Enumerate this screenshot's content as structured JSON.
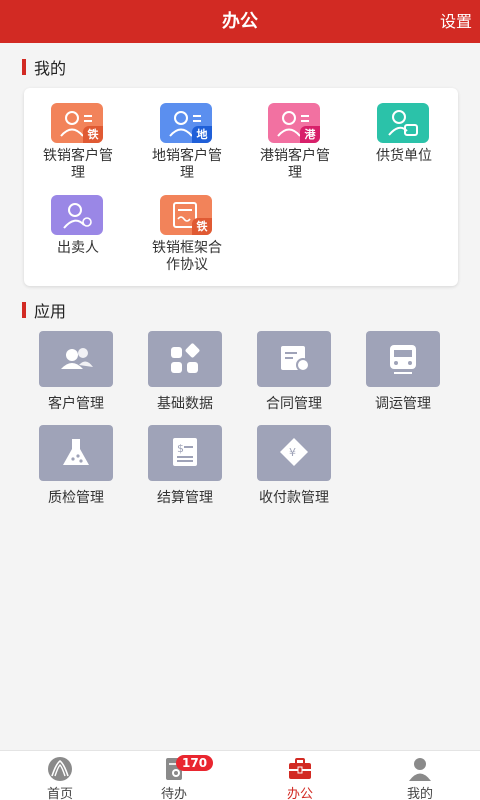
{
  "header": {
    "title": "办公",
    "settings_label": "设置"
  },
  "mine": {
    "title": "我的",
    "items": [
      {
        "label_line1": "铁销客户管",
        "label_line2": "理",
        "icon": "user-list-icon",
        "color": "#f2835a",
        "badge": "铁",
        "badge_color": "#e05a33"
      },
      {
        "label_line1": "地销客户管",
        "label_line2": "理",
        "icon": "user-list-icon",
        "color": "#5b8fef",
        "badge": "地",
        "badge_color": "#1f5fd8"
      },
      {
        "label_line1": "港销客户管",
        "label_line2": "理",
        "icon": "user-list-icon",
        "color": "#f271a1",
        "badge": "港",
        "badge_color": "#d8206a"
      },
      {
        "label_line1": "供货单位",
        "label_line2": "",
        "icon": "supplier-icon",
        "color": "#2bc2a9",
        "badge": "",
        "badge_color": ""
      },
      {
        "label_line1": "出卖人",
        "label_line2": "",
        "icon": "seller-icon",
        "color": "#9a87e6",
        "badge": "",
        "badge_color": ""
      },
      {
        "label_line1": "铁销框架合",
        "label_line2": "作协议",
        "icon": "agreement-icon",
        "color": "#f2835a",
        "badge": "铁",
        "badge_color": "#e05a33"
      }
    ]
  },
  "apps": {
    "title": "应用",
    "items": [
      {
        "label": "客户管理",
        "icon": "customers-icon"
      },
      {
        "label": "基础数据",
        "icon": "grid-icon"
      },
      {
        "label": "合同管理",
        "icon": "contract-icon"
      },
      {
        "label": "调运管理",
        "icon": "train-icon"
      },
      {
        "label": "质检管理",
        "icon": "flask-icon"
      },
      {
        "label": "结算管理",
        "icon": "invoice-icon"
      },
      {
        "label": "收付款管理",
        "icon": "payment-icon"
      }
    ]
  },
  "tabbar": {
    "items": [
      {
        "label": "首页",
        "icon": "home-logo-icon",
        "active": false
      },
      {
        "label": "待办",
        "icon": "todo-icon",
        "active": false
      },
      {
        "label": "办公",
        "icon": "briefcase-icon",
        "active": true
      },
      {
        "label": "我的",
        "icon": "profile-icon",
        "active": false
      }
    ],
    "todo_count": "170"
  },
  "colors": {
    "brand": "#d22a23",
    "app_tile": "#9fa3b8",
    "badge": "#e9262f"
  }
}
